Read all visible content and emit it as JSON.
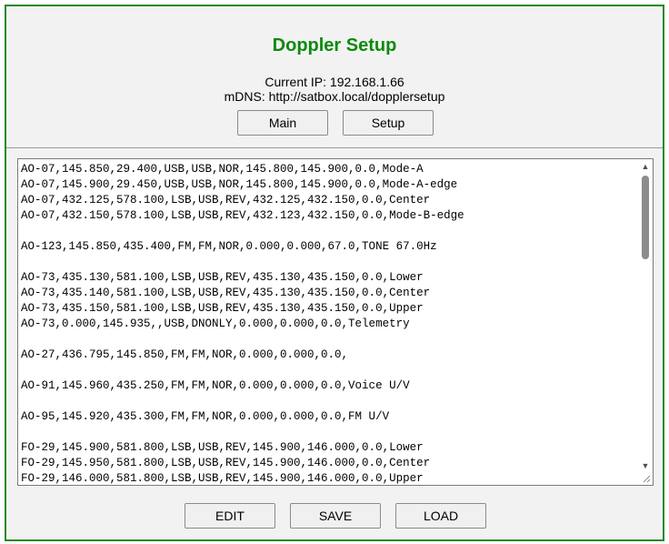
{
  "header": {
    "title": "Doppler Setup",
    "current_ip": "Current IP: 192.168.1.66",
    "mdns": "mDNS: http://satbox.local/dopplersetup"
  },
  "nav": {
    "main_label": "Main",
    "setup_label": "Setup"
  },
  "editor": {
    "lines": [
      "AO-07,145.850,29.400,USB,USB,NOR,145.800,145.900,0.0,Mode-A",
      "AO-07,145.900,29.450,USB,USB,NOR,145.800,145.900,0.0,Mode-A-edge",
      "AO-07,432.125,578.100,LSB,USB,REV,432.125,432.150,0.0,Center",
      "AO-07,432.150,578.100,LSB,USB,REV,432.123,432.150,0.0,Mode-B-edge",
      "",
      "AO-123,145.850,435.400,FM,FM,NOR,0.000,0.000,67.0,TONE 67.0Hz",
      "",
      "AO-73,435.130,581.100,LSB,USB,REV,435.130,435.150,0.0,Lower",
      "AO-73,435.140,581.100,LSB,USB,REV,435.130,435.150,0.0,Center",
      "AO-73,435.150,581.100,LSB,USB,REV,435.130,435.150,0.0,Upper",
      "AO-73,0.000,145.935,,USB,DNONLY,0.000,0.000,0.0,Telemetry",
      "",
      "AO-27,436.795,145.850,FM,FM,NOR,0.000,0.000,0.0,",
      "",
      "AO-91,145.960,435.250,FM,FM,NOR,0.000,0.000,0.0,Voice U/V",
      "",
      "AO-95,145.920,435.300,FM,FM,NOR,0.000,0.000,0.0,FM U/V",
      "",
      "FO-29,145.900,581.800,LSB,USB,REV,145.900,146.000,0.0,Lower",
      "FO-29,145.950,581.800,LSB,USB,REV,145.900,146.000,0.0,Center",
      "FO-29,146.000,581.800,LSB,USB,REV,145.900,146.000,0.0,Upper"
    ],
    "scroll_up_icon": "scroll-up-arrow-icon",
    "scroll_down_icon": "scroll-down-arrow-icon",
    "resize_icon": "resize-grip-icon"
  },
  "actions": {
    "edit_label": "EDIT",
    "save_label": "SAVE",
    "load_label": "LOAD"
  },
  "colors": {
    "title": "#0d8a0d",
    "border": "#1e8a1e",
    "panel": "#f2f2f2"
  }
}
